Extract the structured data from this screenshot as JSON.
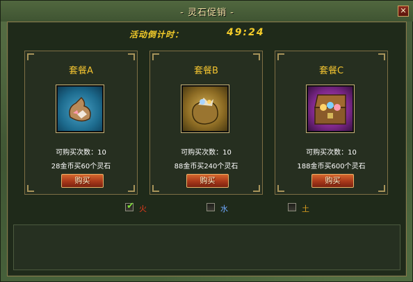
{
  "window": {
    "title": "- 灵石促销 -",
    "close_label": "✕"
  },
  "countdown": {
    "label": "活动倒计时：",
    "value": "49:24"
  },
  "packages": [
    {
      "name": "套餐A",
      "icon": "stone-pouch-blue-icon",
      "buy_count": "可购买次数：10",
      "price": "28金币买60个灵石",
      "buy_label": "购买"
    },
    {
      "name": "套餐B",
      "icon": "stone-bag-gold-icon",
      "buy_count": "可购买次数：10",
      "price": "88金币买240个灵石",
      "buy_label": "购买"
    },
    {
      "name": "套餐C",
      "icon": "treasure-chest-purple-icon",
      "buy_count": "可购买次数：10",
      "price": "188金币买600个灵石",
      "buy_label": "购买"
    }
  ],
  "elements": [
    {
      "label": "火",
      "checked": true,
      "color": "#e53a1c"
    },
    {
      "label": "水",
      "checked": false,
      "color": "#6fa9ff"
    },
    {
      "label": "土",
      "checked": false,
      "color": "#e0a11f"
    }
  ],
  "colors": {
    "accent": "#f4c430",
    "button": "#c04a1f",
    "border": "#7f6f45"
  }
}
